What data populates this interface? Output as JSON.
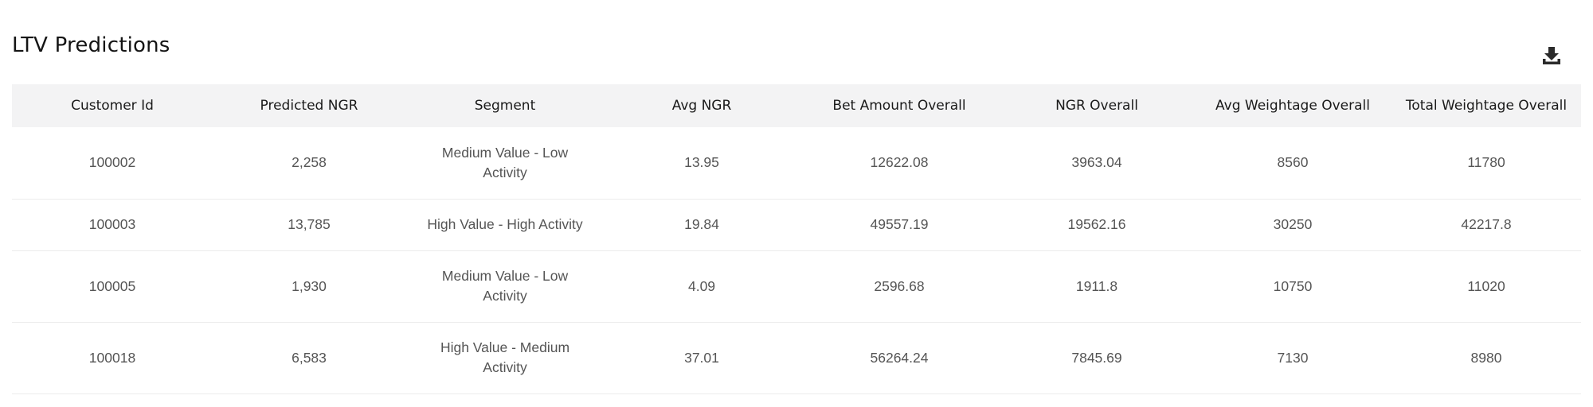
{
  "page": {
    "title": "LTV Predictions",
    "download_icon": "download-icon"
  },
  "table": {
    "columns": [
      "Customer Id",
      "Predicted NGR",
      "Segment",
      "Avg NGR",
      "Bet Amount Overall",
      "NGR Overall",
      "Avg Weightage Overall",
      "Total Weightage Overall"
    ],
    "rows": [
      {
        "customer_id": "100002",
        "predicted_ngr": "2,258",
        "segment": "Medium Value - Low Activity",
        "avg_ngr": "13.95",
        "bet_amount_overall": "12622.08",
        "ngr_overall": "3963.04",
        "avg_weightage_overall": "8560",
        "total_weightage_overall": "11780"
      },
      {
        "customer_id": "100003",
        "predicted_ngr": "13,785",
        "segment": "High Value - High Activity",
        "avg_ngr": "19.84",
        "bet_amount_overall": "49557.19",
        "ngr_overall": "19562.16",
        "avg_weightage_overall": "30250",
        "total_weightage_overall": "42217.8"
      },
      {
        "customer_id": "100005",
        "predicted_ngr": "1,930",
        "segment": "Medium Value - Low Activity",
        "avg_ngr": "4.09",
        "bet_amount_overall": "2596.68",
        "ngr_overall": "1911.8",
        "avg_weightage_overall": "10750",
        "total_weightage_overall": "11020"
      },
      {
        "customer_id": "100018",
        "predicted_ngr": "6,583",
        "segment": "High Value - Medium Activity",
        "avg_ngr": "37.01",
        "bet_amount_overall": "56264.24",
        "ngr_overall": "7845.69",
        "avg_weightage_overall": "7130",
        "total_weightage_overall": "8980"
      }
    ]
  }
}
